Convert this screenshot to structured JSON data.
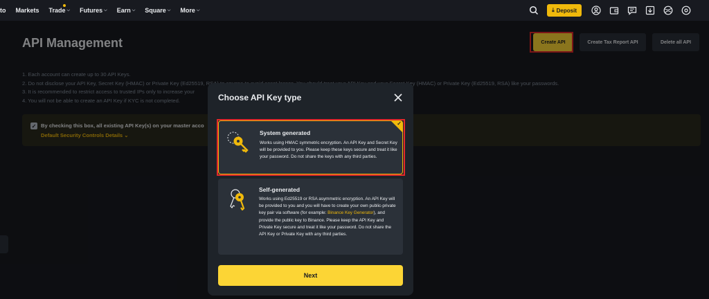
{
  "nav": {
    "items": [
      {
        "label": "to"
      },
      {
        "label": "Markets"
      },
      {
        "label": "Trade",
        "dot": true
      },
      {
        "label": "Futures"
      },
      {
        "label": "Earn"
      },
      {
        "label": "Square"
      },
      {
        "label": "More"
      }
    ],
    "deposit_label": "Deposit",
    "icons": [
      "search-icon",
      "user-icon",
      "wallet-icon",
      "message-icon",
      "download-icon",
      "globe-icon",
      "settings-icon"
    ]
  },
  "page": {
    "title": "API Management",
    "actions": {
      "create": "Create API",
      "tax": "Create Tax Report API",
      "delete": "Delete all API"
    },
    "notes": [
      "1. Each account can create up to 30 API Keys.",
      "2. Do not disclose your API Key, Secret Key (HMAC) or Private Key (Ed25519, RSA) to anyone to avoid asset losses. You should treat your API Key and your Secret Key (HMAC) or Private Key (Ed25519, RSA) like your passwords.",
      "3. It is recommended to restrict access to trusted IPs only to increase your",
      "4. You will not be able to create an API Key if KYC is not completed."
    ],
    "warning": {
      "text": "By checking this box, all existing API Key(s) on your master acco",
      "link": "Default Security Controls Details"
    }
  },
  "modal": {
    "title": "Choose API Key type",
    "options": [
      {
        "title": "System generated",
        "desc": "Works using HMAC symmetric encryption. An API Key and Secret Key will be provided to you. Please keep these keys secure and treat it like your password. Do not share the keys with any third parties."
      },
      {
        "title": "Self-generated",
        "desc_pre": "Works using Ed25519 or RSA asymmetric encryption. An API Key will be provided to you and you will have to create your own public-private key pair via software (for example: ",
        "link": "Binance Key Generator",
        "desc_post": "), and provide the public key to Binance. Please keep the API Key and Private Key secure and treat it like your password. Do not share the API Key or Private Key with any third parties."
      }
    ],
    "next_label": "Next"
  },
  "colors": {
    "accent": "#fcd535",
    "background": "#181a20",
    "modal": "#1e2329",
    "card": "#2b3139",
    "highlight": "#e2282a"
  }
}
